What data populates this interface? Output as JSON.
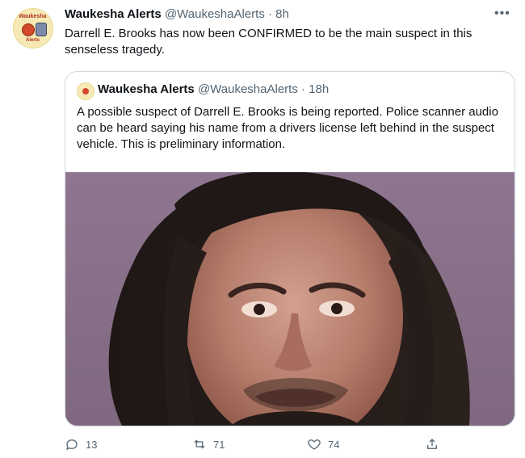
{
  "tweet": {
    "author_name": "Waukesha Alerts",
    "handle": "@WaukeshaAlerts",
    "separator": "·",
    "time": "8h",
    "text": "Darrell E. Brooks has now been CONFIRMED to be the main suspect in this senseless tragedy.",
    "avatar": {
      "text_top": "Waukesha",
      "text_bottom": "Alerts"
    }
  },
  "quote": {
    "author_name": "Waukesha Alerts",
    "handle": "@WaukeshaAlerts",
    "separator": "·",
    "time": "18h",
    "text": "A possible suspect of Darrell E. Brooks is being reported. Police scanner audio can be heard saying his name from a drivers license left behind in the suspect vehicle. This is preliminary information."
  },
  "actions": {
    "reply_count": "13",
    "retweet_count": "71",
    "like_count": "74",
    "icons": [
      "reply-icon",
      "retweet-icon",
      "like-icon",
      "share-icon"
    ]
  },
  "colors": {
    "muted": "#536471",
    "border": "#cfd9de",
    "text": "#0f1419"
  }
}
